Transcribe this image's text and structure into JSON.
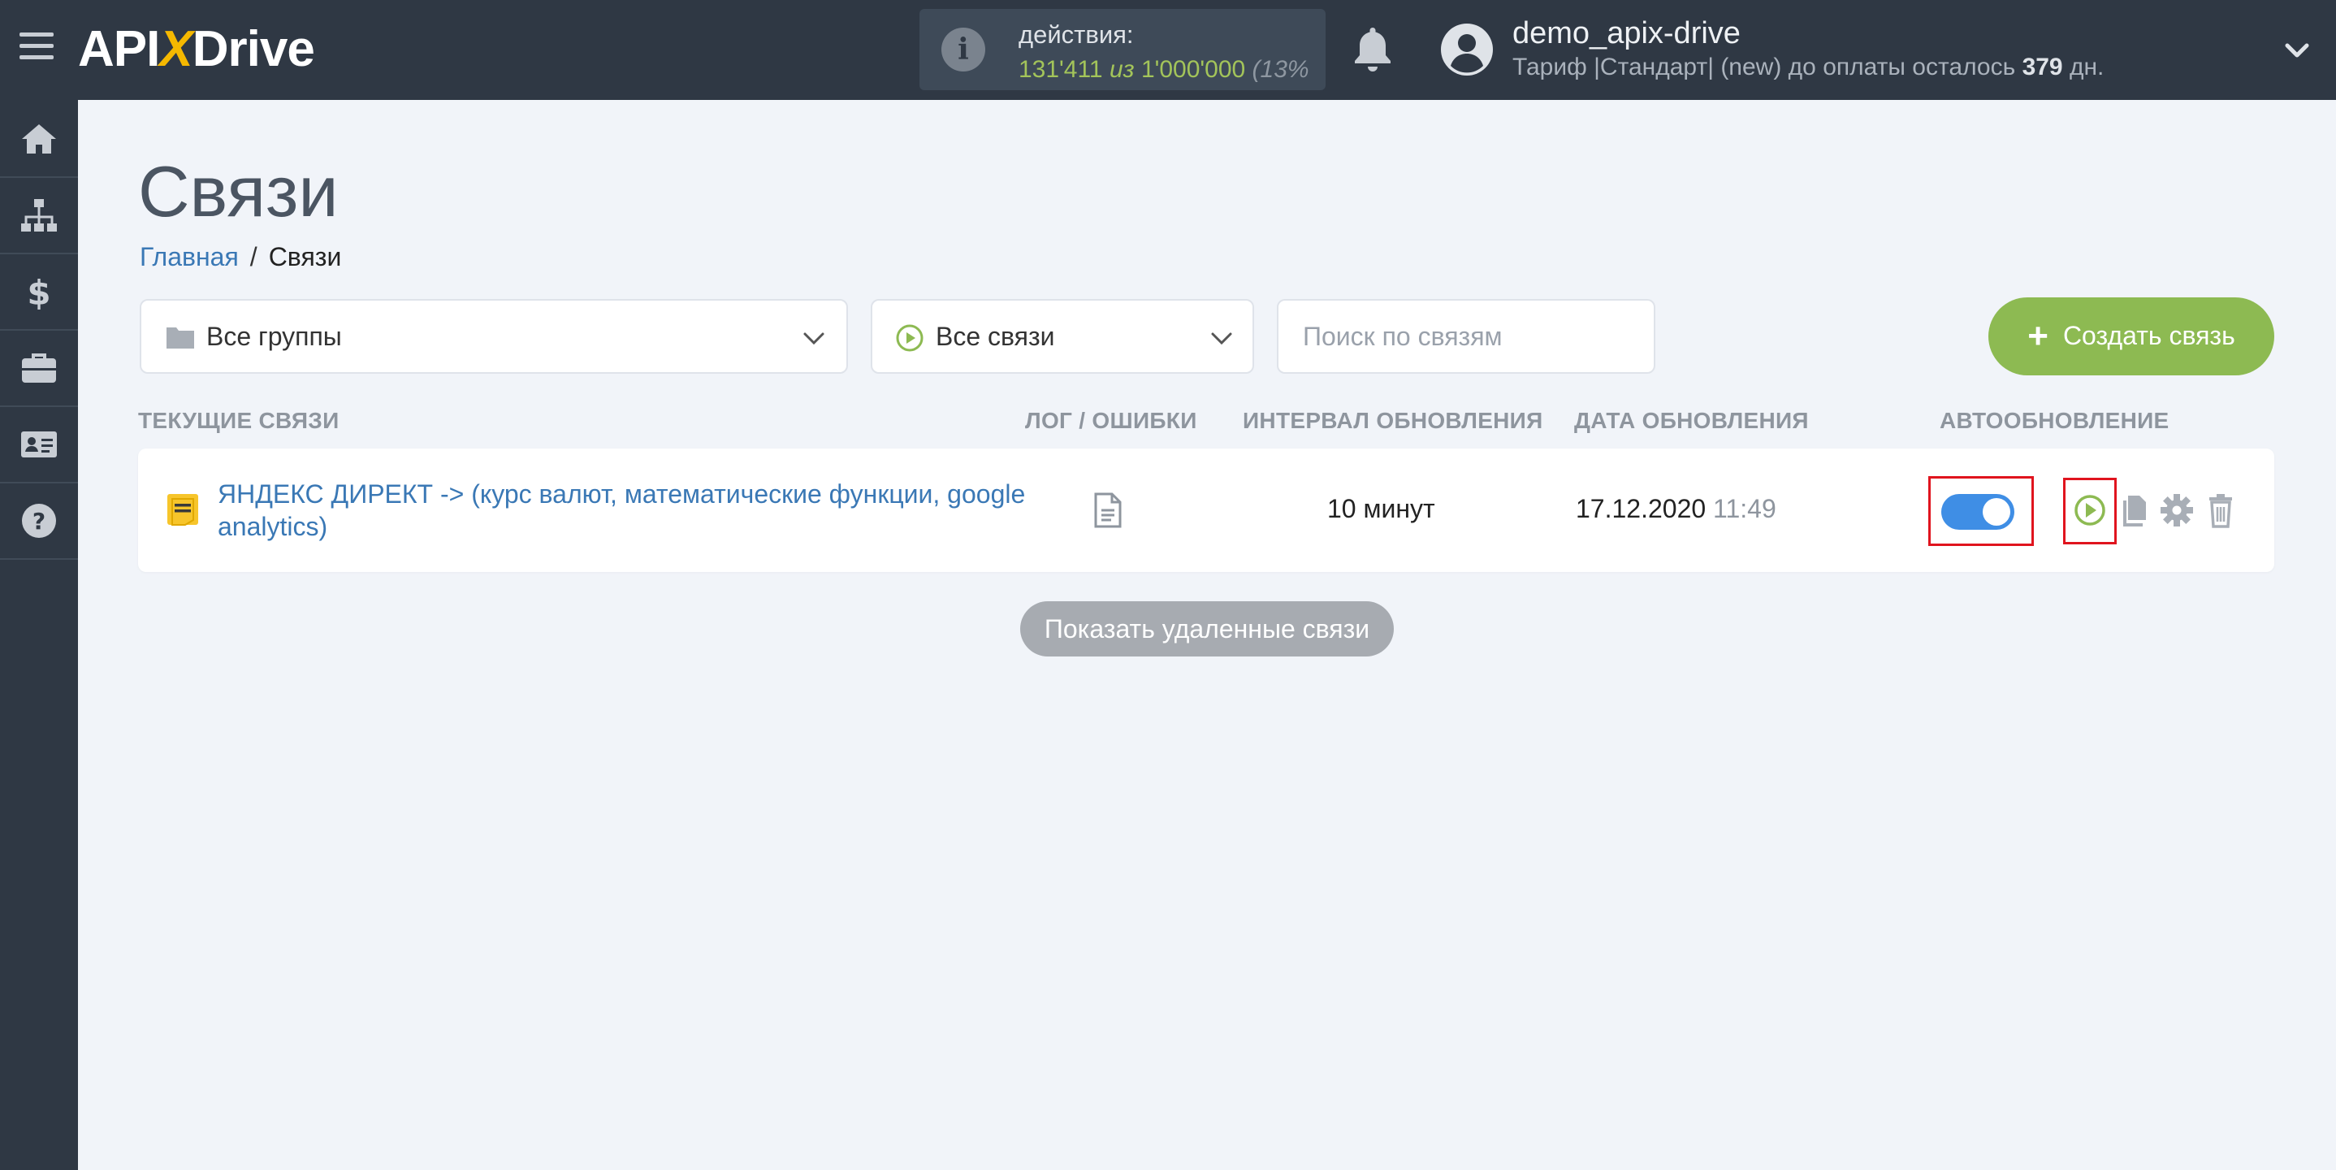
{
  "header": {
    "logo": {
      "left": "API",
      "x": "X",
      "right": "Drive"
    },
    "actions": {
      "label": "действия:",
      "used": "131'411",
      "of": "из",
      "total": "1'000'000",
      "percent": "(13%"
    },
    "user": {
      "name": "demo_apix-drive",
      "tariff_prefix": "Тариф |Стандарт| (new) до оплаты осталось",
      "days": "379",
      "days_suffix": "дн."
    }
  },
  "sidebar": {
    "items": [
      {
        "icon": "home-icon"
      },
      {
        "icon": "sitemap-icon"
      },
      {
        "icon": "dollar-icon"
      },
      {
        "icon": "briefcase-icon"
      },
      {
        "icon": "id-card-icon"
      },
      {
        "icon": "help-icon"
      }
    ]
  },
  "page": {
    "title": "Связи",
    "breadcrumb": {
      "home": "Главная",
      "separator": "/",
      "current": "Связи"
    }
  },
  "filters": {
    "groups": "Все группы",
    "status": "Все связи",
    "search_placeholder": "Поиск по связям",
    "create_label": "Создать связь"
  },
  "table": {
    "headers": {
      "current": "ТЕКУЩИЕ СВЯЗИ",
      "log": "ЛОГ / ОШИБКИ",
      "interval": "ИНТЕРВАЛ ОБНОВЛЕНИЯ",
      "date": "ДАТА ОБНОВЛЕНИЯ",
      "auto": "АВТООБНОВЛЕНИЕ"
    },
    "rows": [
      {
        "name": "ЯНДЕКС ДИРЕКТ -> (курс валют, математические функции, google analytics)",
        "interval": "10 минут",
        "date": "17.12.2020",
        "time": "11:49",
        "autoupdate": true
      }
    ]
  },
  "show_deleted_label": "Показать удаленные связи",
  "colors": {
    "topbar": "#2f3844",
    "accent_green": "#8dba52",
    "toggle_blue": "#3f8ee5",
    "link_blue": "#3a78b5",
    "highlight_red": "#e0141e"
  }
}
